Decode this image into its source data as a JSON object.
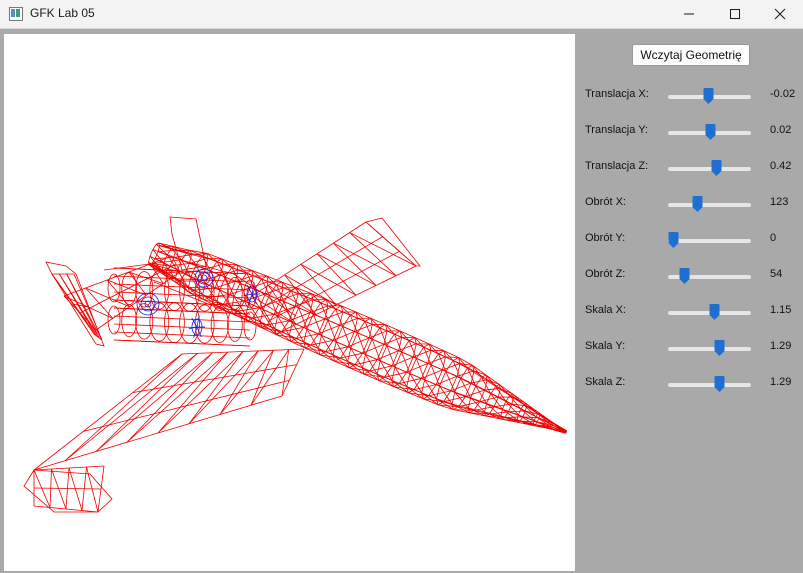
{
  "window": {
    "title": "GFK Lab 05",
    "controls": [
      "minimize-icon",
      "maximize-icon",
      "close-icon"
    ]
  },
  "panel": {
    "load_button": "Wczytaj Geometrię",
    "sliders": [
      {
        "label": "Translacja X:",
        "value": "-0.02",
        "fraction": 0.49
      },
      {
        "label": "Translacja Y:",
        "value": "0.02",
        "fraction": 0.51
      },
      {
        "label": "Translacja Z:",
        "value": "0.42",
        "fraction": 0.6
      },
      {
        "label": "Obrót X:",
        "value": "123",
        "fraction": 0.34
      },
      {
        "label": "Obrót Y:",
        "value": "0",
        "fraction": 0.0
      },
      {
        "label": "Obrót Z:",
        "value": "54",
        "fraction": 0.15
      },
      {
        "label": "Skala X:",
        "value": "1.15",
        "fraction": 0.57
      },
      {
        "label": "Skala Y:",
        "value": "1.29",
        "fraction": 0.64
      },
      {
        "label": "Skala Z:",
        "value": "1.29",
        "fraction": 0.64
      }
    ]
  },
  "colors": {
    "wireframe": "#ee0000",
    "engine_detail": "#1a1adc",
    "slider_thumb": "#1f6fd1",
    "panel_background": "#a9a9a9"
  }
}
